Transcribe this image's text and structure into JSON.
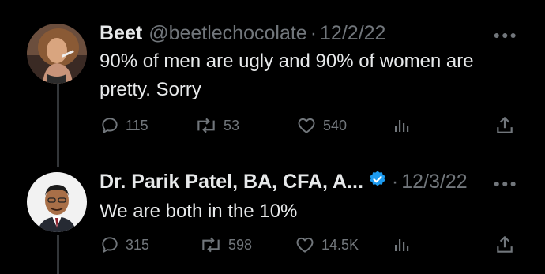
{
  "tweets": [
    {
      "name": "Beet",
      "handle": "@beetlechocolate",
      "separator": "·",
      "date": "12/2/22",
      "text": "90% of men are ugly and 90% of women are pretty. Sorry",
      "verified": false,
      "actions": {
        "replies": "115",
        "retweets": "53",
        "likes": "540"
      }
    },
    {
      "name": "Dr. Parik Patel, BA, CFA, A...",
      "handle": "",
      "separator": "·",
      "date": "12/3/22",
      "text": "We are both in the 10%",
      "verified": true,
      "actions": {
        "replies": "315",
        "retweets": "598",
        "likes": "14.5K"
      }
    }
  ],
  "icons": {
    "more": "more-dots-icon",
    "reply": "reply-icon",
    "retweet": "retweet-icon",
    "like": "heart-icon",
    "views": "views-icon",
    "share": "share-icon",
    "verified": "verified-badge-icon"
  },
  "colors": {
    "background": "#000000",
    "text": "#e7e9ea",
    "muted": "#71767b",
    "verified": "#1d9bf0",
    "thread_line": "#333639"
  }
}
